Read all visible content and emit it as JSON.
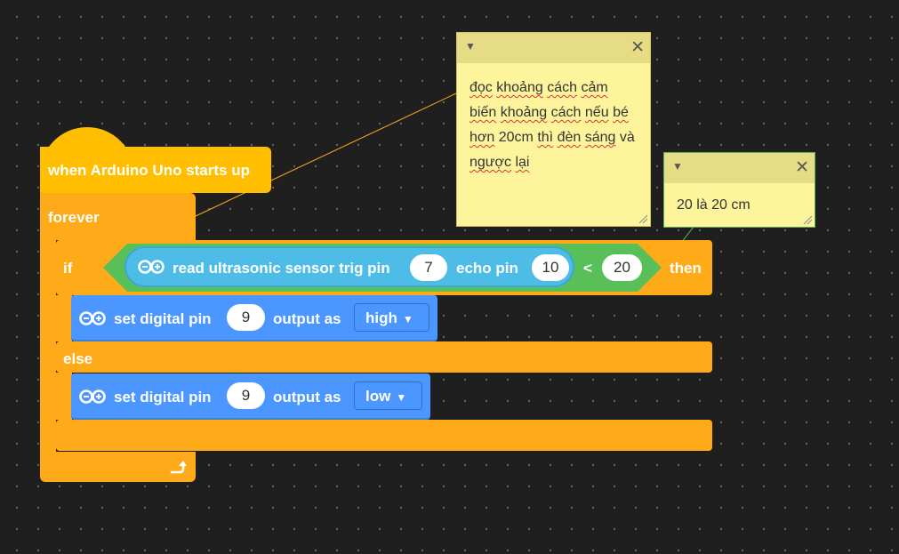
{
  "hat_block": {
    "label": "when Arduino Uno starts up"
  },
  "forever_block": {
    "label": "forever"
  },
  "if_block": {
    "if_label": "if",
    "then_label": "then",
    "else_label": "else",
    "condition": {
      "operator": "<",
      "right_value": "20",
      "reporter": {
        "label_1": "read ultrasonic sensor trig pin",
        "trig_pin": "7",
        "label_2": "echo pin",
        "echo_pin": "10"
      }
    }
  },
  "set_block_1": {
    "label_1": "set digital pin",
    "pin": "9",
    "label_2": "output as",
    "value": "high"
  },
  "set_block_2": {
    "label_1": "set digital pin",
    "pin": "9",
    "label_2": "output as",
    "value": "low"
  },
  "comment_1": {
    "words": [
      "đọc",
      "khoảng",
      "cách",
      "cảm",
      "biến",
      "khoảng",
      "cách",
      "nếu",
      "bé",
      "hơn",
      "20cm",
      "thì",
      "đèn",
      "sáng",
      "và",
      "ngược",
      "lại"
    ]
  },
  "comment_2": {
    "text": "20 là 20 cm"
  },
  "colors": {
    "hat": "#ffbf00",
    "control": "#ffab19",
    "operator": "#59c059",
    "sensor": "#4dbde8",
    "pin": "#4c97ff",
    "note": "#fef49c"
  },
  "icons": {
    "arduino": "infinity-icon",
    "collapse": "caret-down-icon",
    "close": "close-icon",
    "loop": "loop-arrow-icon"
  }
}
